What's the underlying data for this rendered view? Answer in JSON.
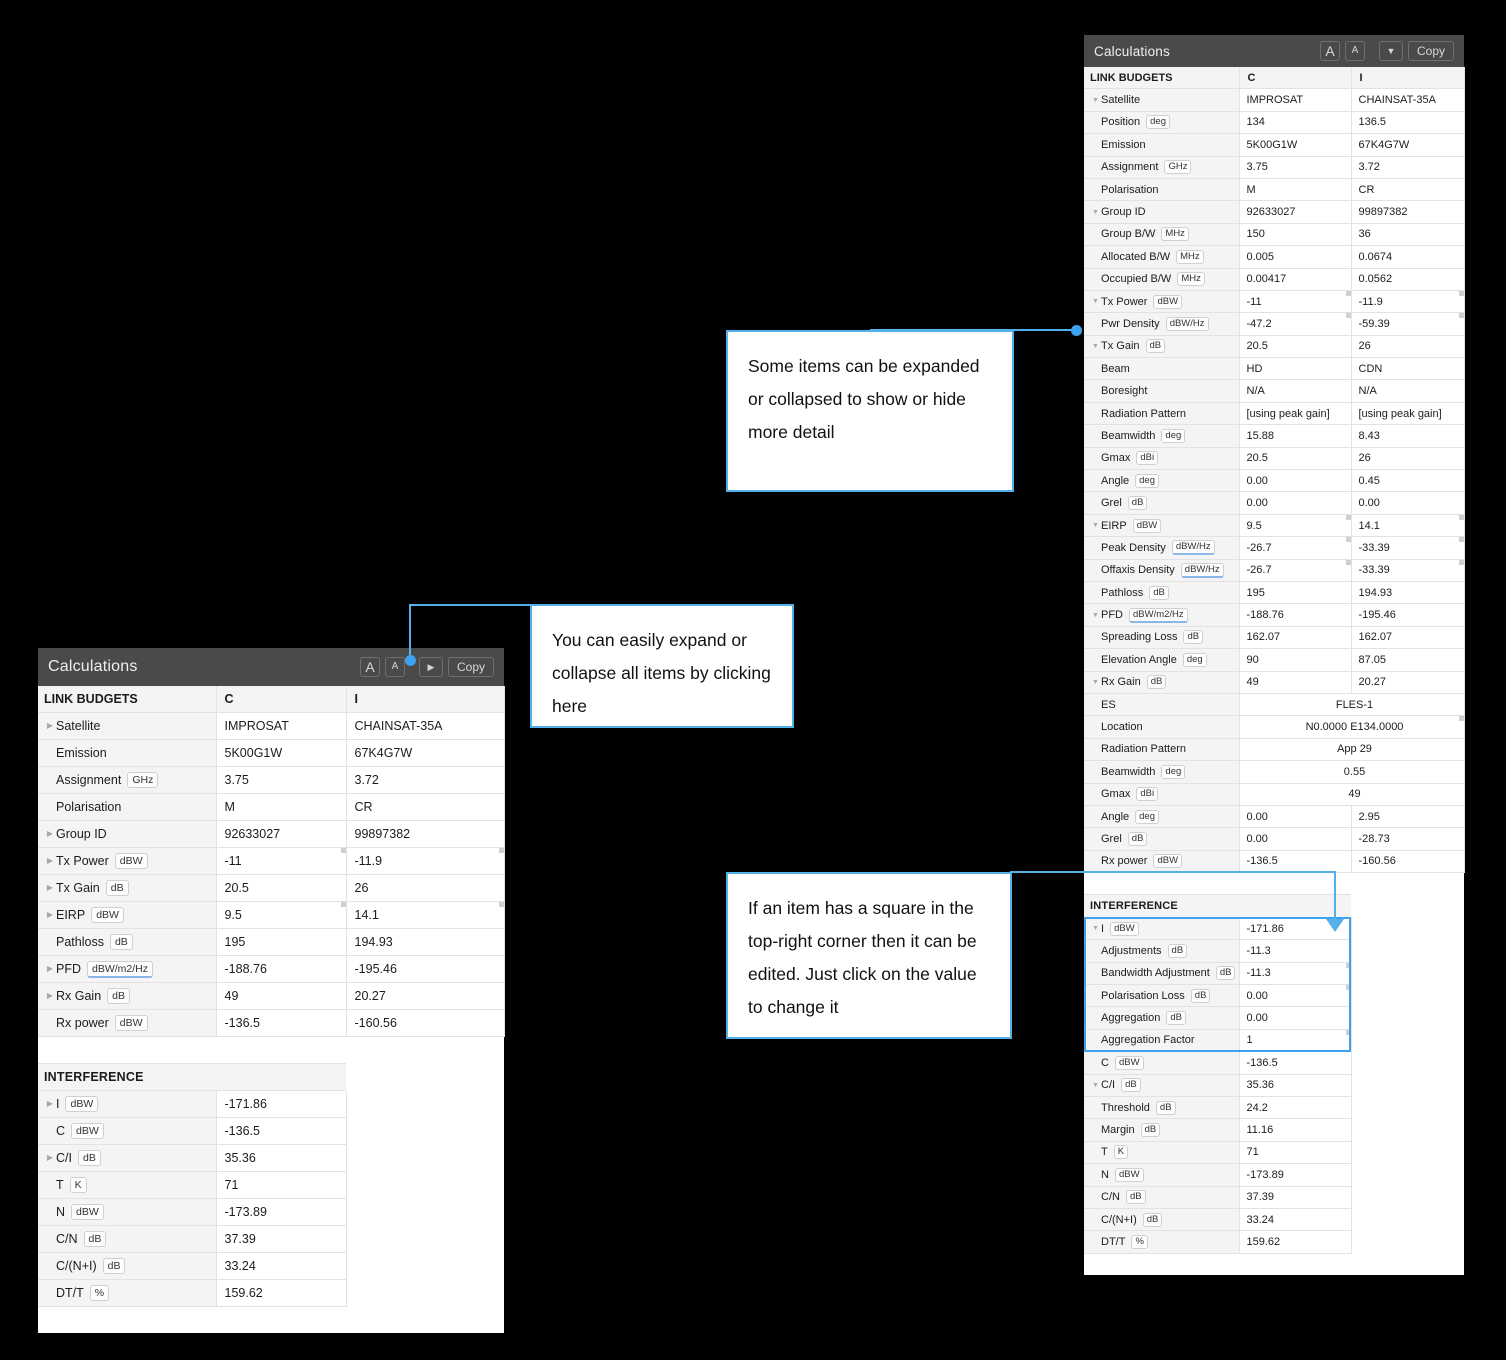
{
  "panels": {
    "left": {
      "title": "Calculations",
      "buttons": {
        "font_big": "A",
        "font_small": "A",
        "expand_toggle": "▶",
        "copy": "Copy"
      },
      "columns": [
        "LINK BUDGETS",
        "C",
        "I"
      ],
      "link_budgets": [
        {
          "tri": "▶",
          "label": "Satellite",
          "unit": "",
          "c": "IMPROSAT",
          "i": "CHAINSAT-35A",
          "editable": false
        },
        {
          "tri": "",
          "label": "Emission",
          "unit": "",
          "c": "5K00G1W",
          "i": "67K4G7W",
          "editable": false
        },
        {
          "tri": "",
          "label": "Assignment",
          "unit": "GHz",
          "c": "3.75",
          "i": "3.72",
          "editable": false
        },
        {
          "tri": "",
          "label": "Polarisation",
          "unit": "",
          "c": "M",
          "i": "CR",
          "editable": false
        },
        {
          "tri": "▶",
          "label": "Group ID",
          "unit": "",
          "c": "92633027",
          "i": "99897382",
          "editable": false
        },
        {
          "tri": "▶",
          "label": "Tx Power",
          "unit": "dBW",
          "c": "-11",
          "i": "-11.9",
          "editable": true
        },
        {
          "tri": "▶",
          "label": "Tx Gain",
          "unit": "dB",
          "c": "20.5",
          "i": "26",
          "editable": false
        },
        {
          "tri": "▶",
          "label": "EIRP",
          "unit": "dBW",
          "c": "9.5",
          "i": "14.1",
          "editable": true
        },
        {
          "tri": "",
          "label": "Pathloss",
          "unit": "dB",
          "c": "195",
          "i": "194.93",
          "editable": false
        },
        {
          "tri": "▶",
          "label": "PFD",
          "unit": "dBW/m2/Hz",
          "unit_drop": true,
          "c": "-188.76",
          "i": "-195.46",
          "editable": false
        },
        {
          "tri": "▶",
          "label": "Rx Gain",
          "unit": "dB",
          "c": "49",
          "i": "20.27",
          "editable": false
        },
        {
          "tri": "",
          "label": "Rx power",
          "unit": "dBW",
          "c": "-136.5",
          "i": "-160.56",
          "editable": false
        }
      ],
      "interference_header": "INTERFERENCE",
      "interference": [
        {
          "tri": "▶",
          "label": "I",
          "unit": "dBW",
          "c": "-171.86",
          "editable": false
        },
        {
          "tri": "",
          "label": "C",
          "unit": "dBW",
          "c": "-136.5",
          "editable": false
        },
        {
          "tri": "▶",
          "label": "C/I",
          "unit": "dB",
          "c": "35.36",
          "editable": false
        },
        {
          "tri": "",
          "label": "T",
          "unit": "K",
          "c": "71",
          "editable": false
        },
        {
          "tri": "",
          "label": "N",
          "unit": "dBW",
          "c": "-173.89",
          "editable": false
        },
        {
          "tri": "",
          "label": "C/N",
          "unit": "dB",
          "c": "37.39",
          "editable": false
        },
        {
          "tri": "",
          "label": "C/(N+I)",
          "unit": "dB",
          "c": "33.24",
          "editable": false
        },
        {
          "tri": "",
          "label": "DT/T",
          "unit": "%",
          "c": "159.62",
          "editable": false
        }
      ]
    },
    "right": {
      "title": "Calculations",
      "buttons": {
        "font_big": "A",
        "font_small": "A",
        "expand_toggle": "▼",
        "copy": "Copy"
      },
      "columns": [
        "LINK BUDGETS",
        "C",
        "I"
      ],
      "link_budgets": [
        {
          "tri": "▼",
          "label": "Satellite",
          "unit": "",
          "c": "IMPROSAT",
          "i": "CHAINSAT-35A",
          "editable": false
        },
        {
          "tri": "",
          "label": "Position",
          "unit": "deg",
          "c": "134",
          "i": "136.5",
          "editable": false
        },
        {
          "tri": "",
          "label": "Emission",
          "unit": "",
          "c": "5K00G1W",
          "i": "67K4G7W",
          "editable": false
        },
        {
          "tri": "",
          "label": "Assignment",
          "unit": "GHz",
          "c": "3.75",
          "i": "3.72",
          "editable": false
        },
        {
          "tri": "",
          "label": "Polarisation",
          "unit": "",
          "c": "M",
          "i": "CR",
          "editable": false
        },
        {
          "tri": "▼",
          "label": "Group ID",
          "unit": "",
          "c": "92633027",
          "i": "99897382",
          "editable": false
        },
        {
          "tri": "",
          "label": "Group B/W",
          "unit": "MHz",
          "c": "150",
          "i": "36",
          "editable": false
        },
        {
          "tri": "",
          "label": "Allocated B/W",
          "unit": "MHz",
          "c": "0.005",
          "i": "0.0674",
          "editable": false
        },
        {
          "tri": "",
          "label": "Occupied B/W",
          "unit": "MHz",
          "c": "0.00417",
          "i": "0.0562",
          "editable": false
        },
        {
          "tri": "▼",
          "label": "Tx Power",
          "unit": "dBW",
          "c": "-11",
          "i": "-11.9",
          "editable": true
        },
        {
          "tri": "",
          "label": "Pwr Density",
          "unit": "dBW/Hz",
          "c": "-47.2",
          "i": "-59.39",
          "editable": true
        },
        {
          "tri": "▼",
          "label": "Tx Gain",
          "unit": "dB",
          "c": "20.5",
          "i": "26",
          "editable": false
        },
        {
          "tri": "",
          "label": "Beam",
          "unit": "",
          "c": "HD",
          "i": "CDN",
          "editable": false
        },
        {
          "tri": "",
          "label": "Boresight",
          "unit": "",
          "c": "N/A",
          "i": "N/A",
          "editable": false
        },
        {
          "tri": "",
          "label": "Radiation Pattern",
          "unit": "",
          "c": "[using peak gain]",
          "i": "[using peak gain]",
          "editable": false
        },
        {
          "tri": "",
          "label": "Beamwidth",
          "unit": "deg",
          "c": "15.88",
          "i": "8.43",
          "editable": false
        },
        {
          "tri": "",
          "label": "Gmax",
          "unit": "dBi",
          "c": "20.5",
          "i": "26",
          "editable": false
        },
        {
          "tri": "",
          "label": "Angle",
          "unit": "deg",
          "c": "0.00",
          "i": "0.45",
          "editable": false
        },
        {
          "tri": "",
          "label": "Grel",
          "unit": "dB",
          "c": "0.00",
          "i": "0.00",
          "editable": false
        },
        {
          "tri": "▼",
          "label": "EIRP",
          "unit": "dBW",
          "c": "9.5",
          "i": "14.1",
          "editable": true
        },
        {
          "tri": "",
          "label": "Peak Density",
          "unit": "dBW/Hz",
          "unit_drop": true,
          "c": "-26.7",
          "i": "-33.39",
          "editable": true
        },
        {
          "tri": "",
          "label": "Offaxis Density",
          "unit": "dBW/Hz",
          "unit_drop": true,
          "c": "-26.7",
          "i": "-33.39",
          "editable": true
        },
        {
          "tri": "",
          "label": "Pathloss",
          "unit": "dB",
          "c": "195",
          "i": "194.93",
          "editable": false
        },
        {
          "tri": "▼",
          "label": "PFD",
          "unit": "dBW/m2/Hz",
          "unit_drop": true,
          "c": "-188.76",
          "i": "-195.46",
          "editable": false
        },
        {
          "tri": "",
          "label": "Spreading Loss",
          "unit": "dB",
          "c": "162.07",
          "i": "162.07",
          "editable": false
        },
        {
          "tri": "",
          "label": "Elevation Angle",
          "unit": "deg",
          "c": "90",
          "i": "87.05",
          "editable": false
        },
        {
          "tri": "▼",
          "label": "Rx Gain",
          "unit": "dB",
          "c": "49",
          "i": "20.27",
          "editable": false
        },
        {
          "tri": "",
          "label": "ES",
          "unit": "",
          "merged": "FLES-1",
          "editable": false
        },
        {
          "tri": "",
          "label": "Location",
          "unit": "",
          "merged": "N0.0000 E134.0000",
          "editable": true
        },
        {
          "tri": "",
          "label": "Radiation Pattern",
          "unit": "",
          "merged": "App 29",
          "editable": false
        },
        {
          "tri": "",
          "label": "Beamwidth",
          "unit": "deg",
          "merged": "0.55",
          "editable": false
        },
        {
          "tri": "",
          "label": "Gmax",
          "unit": "dBi",
          "merged": "49",
          "editable": false
        },
        {
          "tri": "",
          "label": "Angle",
          "unit": "deg",
          "c": "0.00",
          "i": "2.95",
          "editable": false
        },
        {
          "tri": "",
          "label": "Grel",
          "unit": "dB",
          "c": "0.00",
          "i": "-28.73",
          "editable": false
        },
        {
          "tri": "",
          "label": "Rx power",
          "unit": "dBW",
          "c": "-136.5",
          "i": "-160.56",
          "editable": false
        }
      ],
      "interference_header": "INTERFERENCE",
      "interference": [
        {
          "tri": "▼",
          "label": "I",
          "unit": "dBW",
          "c": "-171.86",
          "editable": false
        },
        {
          "tri": "",
          "label": "Adjustments",
          "unit": "dB",
          "c": "-11.3",
          "editable": false
        },
        {
          "tri": "",
          "label": "Bandwidth Adjustment",
          "unit": "dB",
          "c": "-11.3",
          "editable": true
        },
        {
          "tri": "",
          "label": "Polarisation Loss",
          "unit": "dB",
          "c": "0.00",
          "editable": true
        },
        {
          "tri": "",
          "label": "Aggregation",
          "unit": "dB",
          "c": "0.00",
          "editable": false
        },
        {
          "tri": "",
          "label": "Aggregation Factor",
          "unit": "",
          "c": "1",
          "editable": true
        },
        {
          "tri": "",
          "label": "C",
          "unit": "dBW",
          "c": "-136.5",
          "editable": false
        },
        {
          "tri": "▼",
          "label": "C/I",
          "unit": "dB",
          "c": "35.36",
          "editable": false
        },
        {
          "tri": "",
          "label": "Threshold",
          "unit": "dB",
          "c": "24.2",
          "editable": false
        },
        {
          "tri": "",
          "label": "Margin",
          "unit": "dB",
          "c": "11.16",
          "editable": false
        },
        {
          "tri": "",
          "label": "T",
          "unit": "K",
          "c": "71",
          "editable": false
        },
        {
          "tri": "",
          "label": "N",
          "unit": "dBW",
          "c": "-173.89",
          "editable": false
        },
        {
          "tri": "",
          "label": "C/N",
          "unit": "dB",
          "c": "37.39",
          "editable": false
        },
        {
          "tri": "",
          "label": "C/(N+I)",
          "unit": "dB",
          "c": "33.24",
          "editable": false
        },
        {
          "tri": "",
          "label": "DT/T",
          "unit": "%",
          "c": "159.62",
          "editable": false
        }
      ]
    }
  },
  "callouts": [
    {
      "id": "expand-collapse-detail",
      "text": "Some items can be expanded or collapsed to show or hide more detail"
    },
    {
      "id": "expand-all",
      "text": "You can easily expand or collapse all items by clicking here"
    },
    {
      "id": "editable-square",
      "text": "If an item has a square in the top-right corner then it can be edited. Just click on the value to change it"
    }
  ],
  "colors": {
    "accent": "#54b0ea",
    "dot": "#3da2ef",
    "header_bg": "#4a4a4a",
    "row_label_bg": "#f4f4f4"
  }
}
